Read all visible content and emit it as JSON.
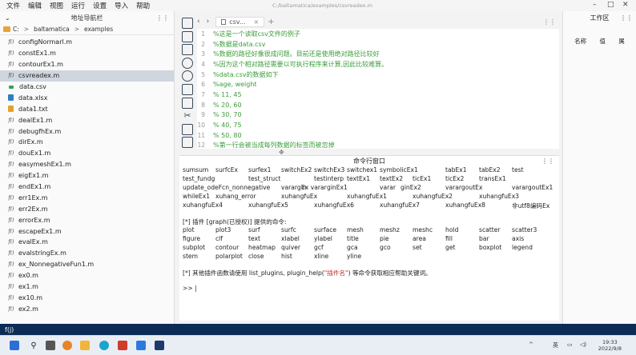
{
  "menubar": {
    "items": [
      "文件",
      "编辑",
      "视图",
      "运行",
      "设置",
      "导入",
      "帮助"
    ]
  },
  "window": {
    "title": "C:/baltamatica/examples/csvreadex.m"
  },
  "file_panel": {
    "title": "地址导航栏",
    "breadcrumb": [
      "C:",
      "baltamatica",
      "examples"
    ],
    "files": [
      {
        "name": "configNormarl.m",
        "type": "m"
      },
      {
        "name": "constEx1.m",
        "type": "m"
      },
      {
        "name": "contourEx1.m",
        "type": "m"
      },
      {
        "name": "csvreadex.m",
        "type": "m",
        "selected": true
      },
      {
        "name": "data.csv",
        "type": "csv"
      },
      {
        "name": "data.xlsx",
        "type": "xlsx"
      },
      {
        "name": "data1.txt",
        "type": "txt"
      },
      {
        "name": "dealEx1.m",
        "type": "m"
      },
      {
        "name": "debugfhEx.m",
        "type": "m"
      },
      {
        "name": "dirEx.m",
        "type": "m"
      },
      {
        "name": "douEx1.m",
        "type": "m"
      },
      {
        "name": "easymeshEx1.m",
        "type": "m"
      },
      {
        "name": "eigEx1.m",
        "type": "m"
      },
      {
        "name": "endEx1.m",
        "type": "m"
      },
      {
        "name": "err1Ex.m",
        "type": "m"
      },
      {
        "name": "err2Ex.m",
        "type": "m"
      },
      {
        "name": "errorEx.m",
        "type": "m"
      },
      {
        "name": "escapeEx1.m",
        "type": "m"
      },
      {
        "name": "evalEx.m",
        "type": "m"
      },
      {
        "name": "evalstringEx.m",
        "type": "m"
      },
      {
        "name": "ex_NonnegativeFun1.m",
        "type": "m"
      },
      {
        "name": "ex0.m",
        "type": "m"
      },
      {
        "name": "ex1.m",
        "type": "m"
      },
      {
        "name": "ex10.m",
        "type": "m"
      },
      {
        "name": "ex2.m",
        "type": "m"
      }
    ]
  },
  "editor": {
    "tab_label": "csv...",
    "lines": [
      {
        "n": "1",
        "text": "%这是一个读取csv文件的例子"
      },
      {
        "n": "2",
        "text": "%数据是data.csv"
      },
      {
        "n": "3",
        "text": "%数据的路径好像很成问题。目前还是使用绝对路径比较好"
      },
      {
        "n": "4",
        "text": "%因为这个相对路径需要以可执行程序来计算,因此比较难算。"
      },
      {
        "n": "5",
        "text": "%data.csv的数据如下"
      },
      {
        "n": "6",
        "text": "%age, weight"
      },
      {
        "n": "7",
        "text": "% 11, 45"
      },
      {
        "n": "8",
        "text": "% 20, 60"
      },
      {
        "n": "9",
        "text": "% 30, 70"
      },
      {
        "n": "10",
        "text": "% 40, 75"
      },
      {
        "n": "11",
        "text": "% 50, 80"
      },
      {
        "n": "12",
        "text": "%第一行会被当成每列数据的标签而被忽掉"
      }
    ]
  },
  "command_window": {
    "title": "命令行窗口",
    "row1": [
      "sumsum",
      "surfcEx",
      "surfex1",
      "switchEx2",
      "switchEx3",
      "switchex1",
      "symbolicEx1",
      "tabEx1",
      "tabEx2",
      "test"
    ],
    "row2": [
      "test_fundg",
      "test_struct",
      "testinterp",
      "textEx1",
      "textEx2",
      "ticEx1",
      "ticEx2",
      "transEx1"
    ],
    "row3": [
      "update_odeFcn_nonnegative",
      "varargin",
      "Ex varar",
      "ginEx1",
      "varar",
      "ginEx2",
      "varargoutEx",
      "varargoutEx1"
    ],
    "row4": [
      "whileEx1",
      "xuhang_error",
      "xuhangfuEx",
      "xuhangfuEx1",
      "xuhangfuEx2",
      "xuhangfuEx3"
    ],
    "row5": [
      "xuhangfuEx4",
      "xuhangfuEx5",
      "xuhangfuEx6",
      "xuhangfuEx7",
      "xuhangfuEx8",
      "非utf8编码Ex"
    ],
    "plugin_line_a": "[*] 插件 ",
    "plugin_line_b": "[graph(已授权)]",
    "plugin_line_c": " 提供的命令:",
    "prow1": [
      "plot",
      "plot3",
      "surf",
      "surfc",
      "surface",
      "mesh",
      "meshz",
      "meshc",
      "hold",
      "scatter",
      "scatter3"
    ],
    "prow2": [
      "figure",
      "clf",
      "text",
      "xlabel",
      "ylabel",
      "title",
      "pie",
      "area",
      "fill",
      "bar",
      "axis"
    ],
    "prow3": [
      "subplot",
      "contour",
      "heatmap",
      "quiver",
      "gcf",
      "gca",
      "gco",
      "set",
      "get",
      "boxplot",
      "legend"
    ],
    "prow4": [
      "stem",
      "polarplot",
      "close",
      "hist",
      "xline",
      "yline"
    ],
    "help_a": "[*] 其他插件函数请使用 list_plugins, plugin_help(",
    "help_b": "\"插件名\"",
    "help_c": ") 等命令获取相应帮助关键词。",
    "prompt": ">> |"
  },
  "workspace": {
    "title": "工作区",
    "columns": [
      "名称",
      "值",
      "属"
    ]
  },
  "statusbar": {
    "text": "f(j)"
  },
  "taskbar": {
    "tray": "英",
    "time": "19:33",
    "date": "2022/9/8"
  }
}
